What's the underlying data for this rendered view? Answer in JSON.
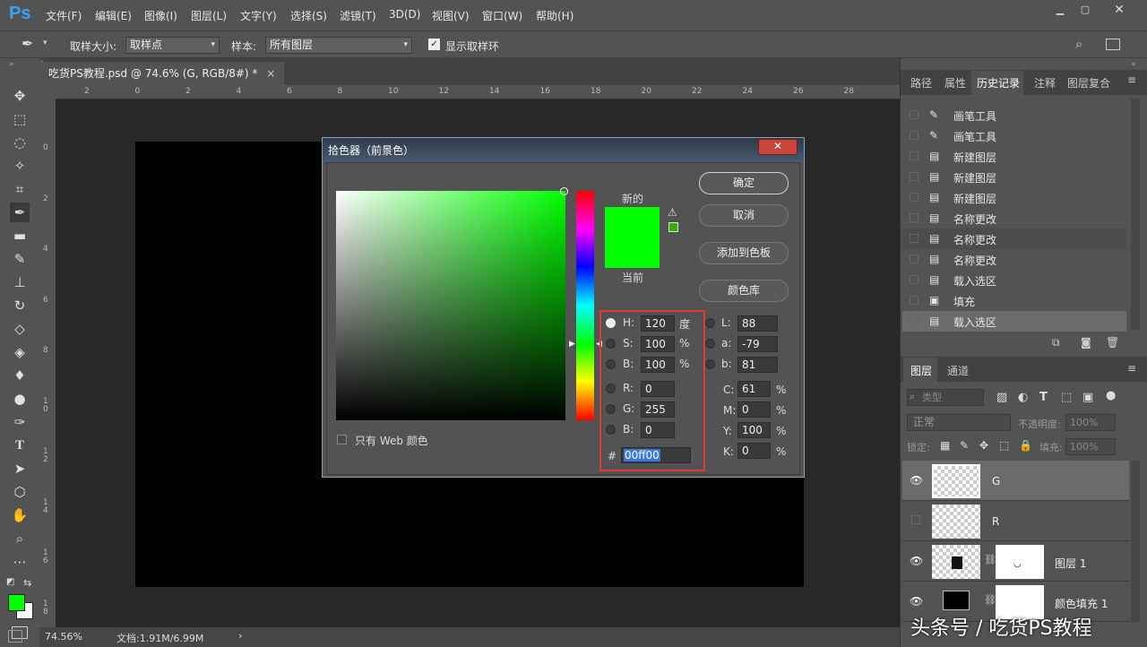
{
  "app": {
    "logo": "Ps"
  },
  "menu": [
    "文件(F)",
    "编辑(E)",
    "图像(I)",
    "图层(L)",
    "文字(Y)",
    "选择(S)",
    "滤镜(T)",
    "3D(D)",
    "视图(V)",
    "窗口(W)",
    "帮助(H)"
  ],
  "options": {
    "sample_size_label": "取样大小:",
    "sample_size_value": "取样点",
    "sample_label": "样本:",
    "sample_value": "所有图层",
    "show_ring_label": "显示取样环"
  },
  "document": {
    "tab_title": "吃货PS教程.psd @ 74.6% (G, RGB/8#) *",
    "zoom": "74.56%",
    "doc_size": "文档:1.91M/6.99M"
  },
  "ruler_h": [
    "2",
    "0",
    "2",
    "4",
    "6",
    "8",
    "10",
    "12",
    "14",
    "16",
    "18",
    "20",
    "22",
    "24",
    "26",
    "28"
  ],
  "ruler_v": [
    "0",
    "2",
    "4",
    "6",
    "8",
    "1\n0",
    "1\n2",
    "1\n4",
    "1\n6",
    "1\n8"
  ],
  "panels": {
    "top_tabs": [
      "路径",
      "属性",
      "历史记录",
      "注释",
      "图层复合"
    ],
    "active_top_tab": "历史记录",
    "history": [
      "画笔工具",
      "画笔工具",
      "新建图层",
      "新建图层",
      "新建图层",
      "名称更改",
      "名称更改",
      "名称更改",
      "载入选区",
      "填充",
      "载入选区"
    ],
    "layer_tabs": [
      "图层",
      "通道"
    ],
    "layer_kind_placeholder": "类型",
    "blend_mode": "正常",
    "opacity_label": "不透明度:",
    "opacity_value": "100%",
    "lock_label": "锁定:",
    "fill_label": "填充:",
    "fill_value": "100%",
    "layers": [
      {
        "name": "G",
        "visible": true
      },
      {
        "name": "R",
        "visible": false
      },
      {
        "name": "图层 1",
        "visible": true
      },
      {
        "name": "颜色填充 1",
        "visible": true
      }
    ]
  },
  "dialog": {
    "title": "拾色器（前景色）",
    "close": "✕",
    "new_label": "新的",
    "current_label": "当前",
    "current_color": "#00ff00",
    "buttons": {
      "ok": "确定",
      "cancel": "取消",
      "add_swatch": "添加到色板",
      "libraries": "颜色库"
    },
    "web_only_label": "只有 Web 颜色",
    "fields": {
      "H": {
        "label": "H:",
        "value": "120",
        "unit": "度"
      },
      "S": {
        "label": "S:",
        "value": "100",
        "unit": "%"
      },
      "Bv": {
        "label": "B:",
        "value": "100",
        "unit": "%"
      },
      "R": {
        "label": "R:",
        "value": "0"
      },
      "G": {
        "label": "G:",
        "value": "255"
      },
      "Bc": {
        "label": "B:",
        "value": "0"
      },
      "L": {
        "label": "L:",
        "value": "88"
      },
      "a": {
        "label": "a:",
        "value": "-79"
      },
      "b": {
        "label": "b:",
        "value": "81"
      },
      "C": {
        "label": "C:",
        "value": "61",
        "unit": "%"
      },
      "M": {
        "label": "M:",
        "value": "0",
        "unit": "%"
      },
      "Y": {
        "label": "Y:",
        "value": "100",
        "unit": "%"
      },
      "K": {
        "label": "K:",
        "value": "0",
        "unit": "%"
      },
      "hex": {
        "label": "#",
        "value": "00ff00"
      }
    }
  },
  "watermark": "头条号 / 吃货PS教程"
}
